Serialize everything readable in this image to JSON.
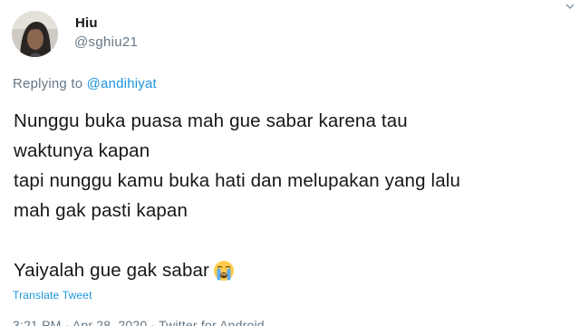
{
  "user": {
    "display_name": "Hiu",
    "handle": "@sghiu21"
  },
  "reply": {
    "prefix": "Replying to",
    "mention": "@andihiyat"
  },
  "tweet": {
    "lines": [
      "Nunggu buka puasa mah gue sabar karena tau",
      "waktunya kapan",
      "tapi nunggu kamu buka hati dan melupakan yang lalu",
      "mah gak pasti kapan",
      "",
      "Yaiyalah gue gak sabar"
    ],
    "emoji": "loudly-crying-face-emoji"
  },
  "actions": {
    "translate_label": "Translate Tweet"
  },
  "meta": {
    "timestamp_partial": "3:21 PM · Apr 28, 2020 · Twitter for Android"
  },
  "colors": {
    "text": "#14171a",
    "secondary": "#657786",
    "link": "#1b95e0"
  }
}
